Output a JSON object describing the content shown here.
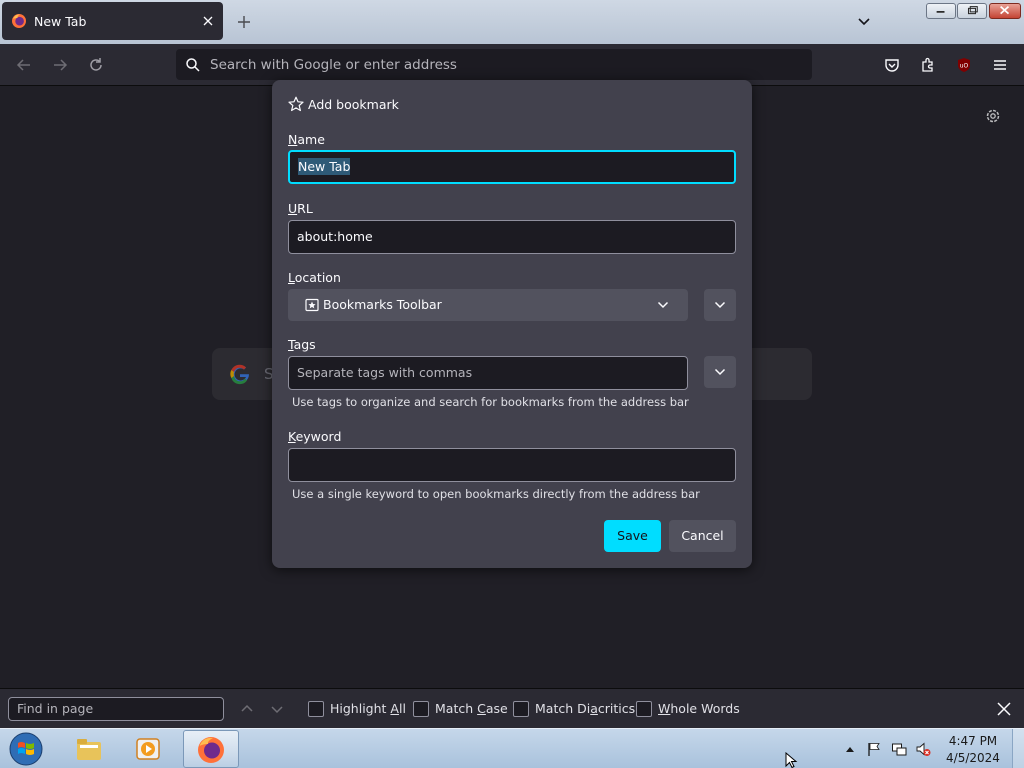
{
  "tab": {
    "title": "New Tab"
  },
  "urlbar": {
    "placeholder": "Search with Google or enter address"
  },
  "search_box": {
    "visible_text": "S"
  },
  "dialog": {
    "title": "Add bookmark",
    "name_label_u": "N",
    "name_label_rest": "ame",
    "name_value": "New Tab",
    "url_label_u": "U",
    "url_label_rest": "RL",
    "url_value": "about:home",
    "location_label_u": "L",
    "location_label_rest": "ocation",
    "location_value": "Bookmarks Toolbar",
    "tags_label_u": "T",
    "tags_label_rest": "ags",
    "tags_placeholder": "Separate tags with commas",
    "tags_hint": "Use tags to organize and search for bookmarks from the address bar",
    "keyword_label_u": "K",
    "keyword_label_rest": "eyword",
    "keyword_value": "",
    "keyword_hint": "Use a single keyword to open bookmarks directly from the address bar",
    "save_label": "Save",
    "cancel_label": "Cancel"
  },
  "findbar": {
    "placeholder": "Find in page",
    "highlight_all_pre": "Highlight ",
    "highlight_all_u": "A",
    "highlight_all_post": "ll",
    "match_case_pre": "Match ",
    "match_case_u": "C",
    "match_case_post": "ase",
    "match_diacritics_pre": "Match Di",
    "match_diacritics_u": "a",
    "match_diacritics_post": "critics",
    "whole_words_u": "W",
    "whole_words_post": "hole Words"
  },
  "taskbar": {
    "clock_time": "4:47 PM",
    "clock_date": "4/5/2024"
  },
  "icons": {
    "tab_favicon": "firefox-icon",
    "urlbar_search": "search-icon",
    "dialog_star": "star-icon",
    "location_folder": "bookmarks-toolbar-icon"
  },
  "colors": {
    "accent": "#00ddff",
    "dialog_bg": "#42414d",
    "page_bg": "#1c1b22",
    "toolbar_bg": "#2b2a33"
  }
}
